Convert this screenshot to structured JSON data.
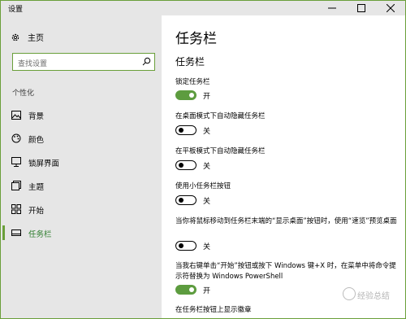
{
  "window": {
    "title": "设置"
  },
  "sidebar": {
    "home_label": "主页",
    "search_placeholder": "查找设置",
    "section_label": "个性化",
    "items": [
      {
        "label": "背景",
        "icon": "image-icon",
        "active": false
      },
      {
        "label": "颜色",
        "icon": "palette-icon",
        "active": false
      },
      {
        "label": "锁屏界面",
        "icon": "monitor-icon",
        "active": false
      },
      {
        "label": "主题",
        "icon": "theme-icon",
        "active": false
      },
      {
        "label": "开始",
        "icon": "start-icon",
        "active": false
      },
      {
        "label": "任务栏",
        "icon": "taskbar-icon",
        "active": true
      }
    ]
  },
  "main": {
    "title": "任务栏",
    "subtitle": "任务栏",
    "settings": [
      {
        "label": "锁定任务栏",
        "state": "开",
        "on": true
      },
      {
        "label": "在桌面模式下自动隐藏任务栏",
        "state": "关",
        "on": false
      },
      {
        "label": "在平板模式下自动隐藏任务栏",
        "state": "关",
        "on": false
      },
      {
        "label": "使用小任务栏按钮",
        "state": "关",
        "on": false
      },
      {
        "label": "当你将鼠标移动到任务栏末端的“显示桌面”按钮时，使用“速览”预览桌面",
        "state": "关",
        "on": false
      },
      {
        "label": "当我右键单击“开始”按钮或按下 Windows 键+X 时，在菜单中将命令提示符替换为 Windows PowerShell",
        "state": "开",
        "on": true
      },
      {
        "label": "在任务栏按钮上显示徽章",
        "state": "",
        "on": true
      }
    ]
  },
  "colors": {
    "accent": "#5d9c3f",
    "sidebar_bg": "#e6e6e6"
  },
  "watermark": {
    "text": "经验总结"
  }
}
